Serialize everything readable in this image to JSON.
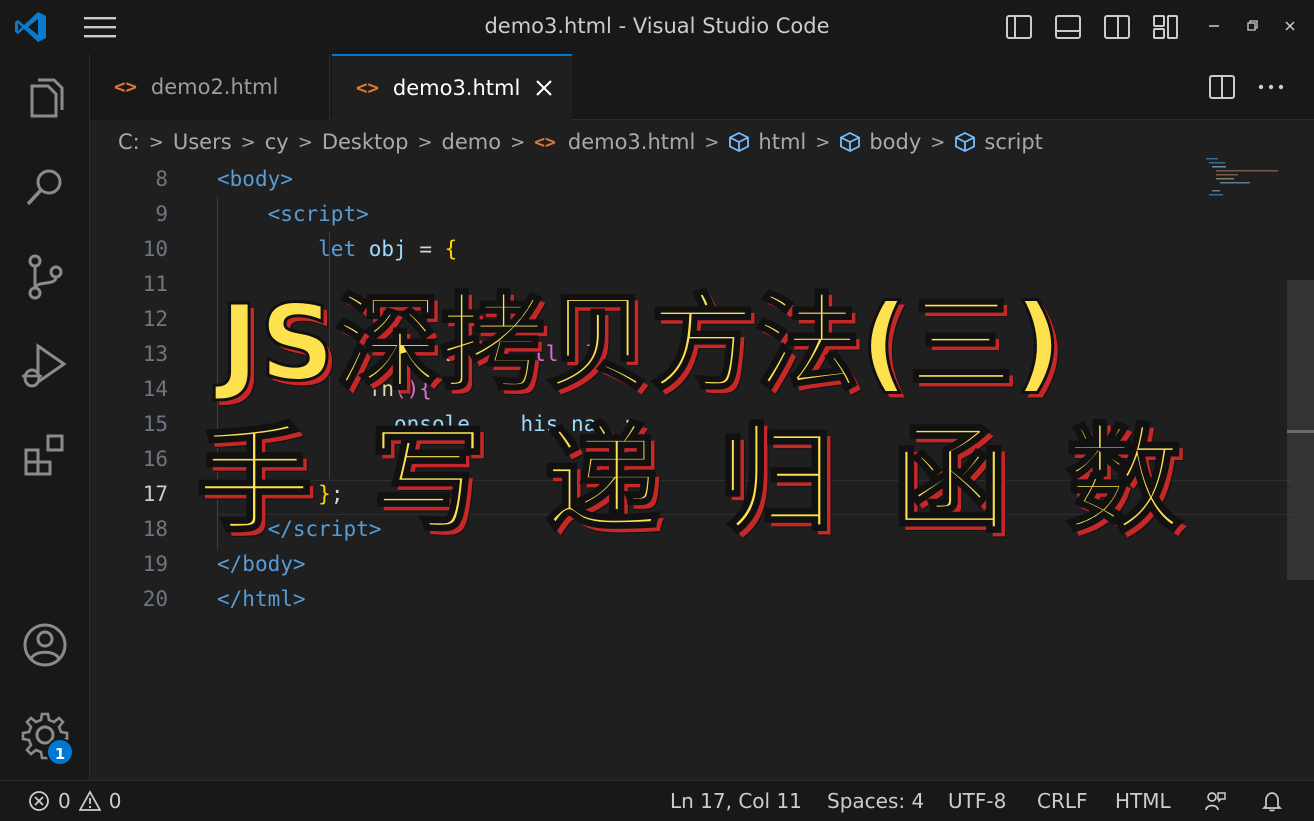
{
  "window": {
    "title": "demo3.html - Visual Studio Code"
  },
  "tabs": [
    {
      "label": "demo2.html",
      "icon": "html-file-icon",
      "active": false
    },
    {
      "label": "demo3.html",
      "icon": "html-file-icon",
      "active": true
    }
  ],
  "file_icon_glyph": "<>",
  "breadcrumb": [
    "C:",
    "Users",
    "cy",
    "Desktop",
    "demo",
    "demo3.html",
    "html",
    "body",
    "script"
  ],
  "breadcrumb_sep": ">",
  "editor": {
    "current_line": 17,
    "lines": [
      {
        "n": "8",
        "tokens": [
          [
            "tag",
            "<"
          ],
          [
            "tag",
            "body"
          ],
          [
            "tag",
            ">"
          ]
        ]
      },
      {
        "n": "9",
        "tokens": [
          [
            "ws",
            "    "
          ],
          [
            "tag",
            "<"
          ],
          [
            "tag",
            "script"
          ],
          [
            "tag",
            ">"
          ]
        ]
      },
      {
        "n": "10",
        "tokens": [
          [
            "ws",
            "        "
          ],
          [
            "kw",
            "let"
          ],
          [
            "ws",
            " "
          ],
          [
            "var",
            "obj"
          ],
          [
            "op",
            " = "
          ],
          [
            "brace",
            "{"
          ]
        ]
      },
      {
        "n": "11",
        "tokens": []
      },
      {
        "n": "12",
        "tokens": []
      },
      {
        "n": "13",
        "tokens": [
          [
            "ws",
            "            "
          ],
          [
            "punc",
            "      sw   , "
          ],
          [
            "paren",
            "ll  ]"
          ]
        ]
      },
      {
        "n": "14",
        "tokens": [
          [
            "ws",
            "            "
          ],
          [
            "fn",
            "fn"
          ],
          [
            "paren",
            "(){"
          ]
        ]
      },
      {
        "n": "15",
        "tokens": [
          [
            "ws",
            "              "
          ],
          [
            "var",
            "onsole"
          ],
          [
            "punc",
            "    "
          ],
          [
            "var",
            "his"
          ],
          [
            "punc",
            "."
          ],
          [
            "var",
            "na"
          ],
          [
            "punc",
            "  ;"
          ]
        ]
      },
      {
        "n": "16",
        "tokens": []
      },
      {
        "n": "17",
        "tokens": [
          [
            "ws",
            "        "
          ],
          [
            "brace",
            "}"
          ],
          [
            "punc",
            ";"
          ]
        ]
      },
      {
        "n": "18",
        "tokens": [
          [
            "ws",
            "    "
          ],
          [
            "tag",
            "</"
          ],
          [
            "tag",
            "script"
          ],
          [
            "tag",
            ">"
          ]
        ]
      },
      {
        "n": "19",
        "tokens": [
          [
            "tag",
            "</"
          ],
          [
            "tag",
            "body"
          ],
          [
            "tag",
            ">"
          ]
        ]
      },
      {
        "n": "20",
        "tokens": [
          [
            "tag",
            "</"
          ],
          [
            "tag",
            "html"
          ],
          [
            "tag",
            ">"
          ]
        ]
      }
    ]
  },
  "overlay": {
    "line1": "JS深拷贝方法(三)",
    "line2": "手写递归函数"
  },
  "activity_badge": "1",
  "status": {
    "errors": "0",
    "warnings": "0",
    "cursor": "Ln 17, Col 11",
    "spaces": "Spaces: 4",
    "encoding": "UTF-8",
    "eol": "CRLF",
    "language": "HTML"
  },
  "colors": {
    "accent": "#0078d4",
    "headline_fill": "#fde14f",
    "headline_shadow": "#c62828",
    "html_icon": "#e37933"
  }
}
